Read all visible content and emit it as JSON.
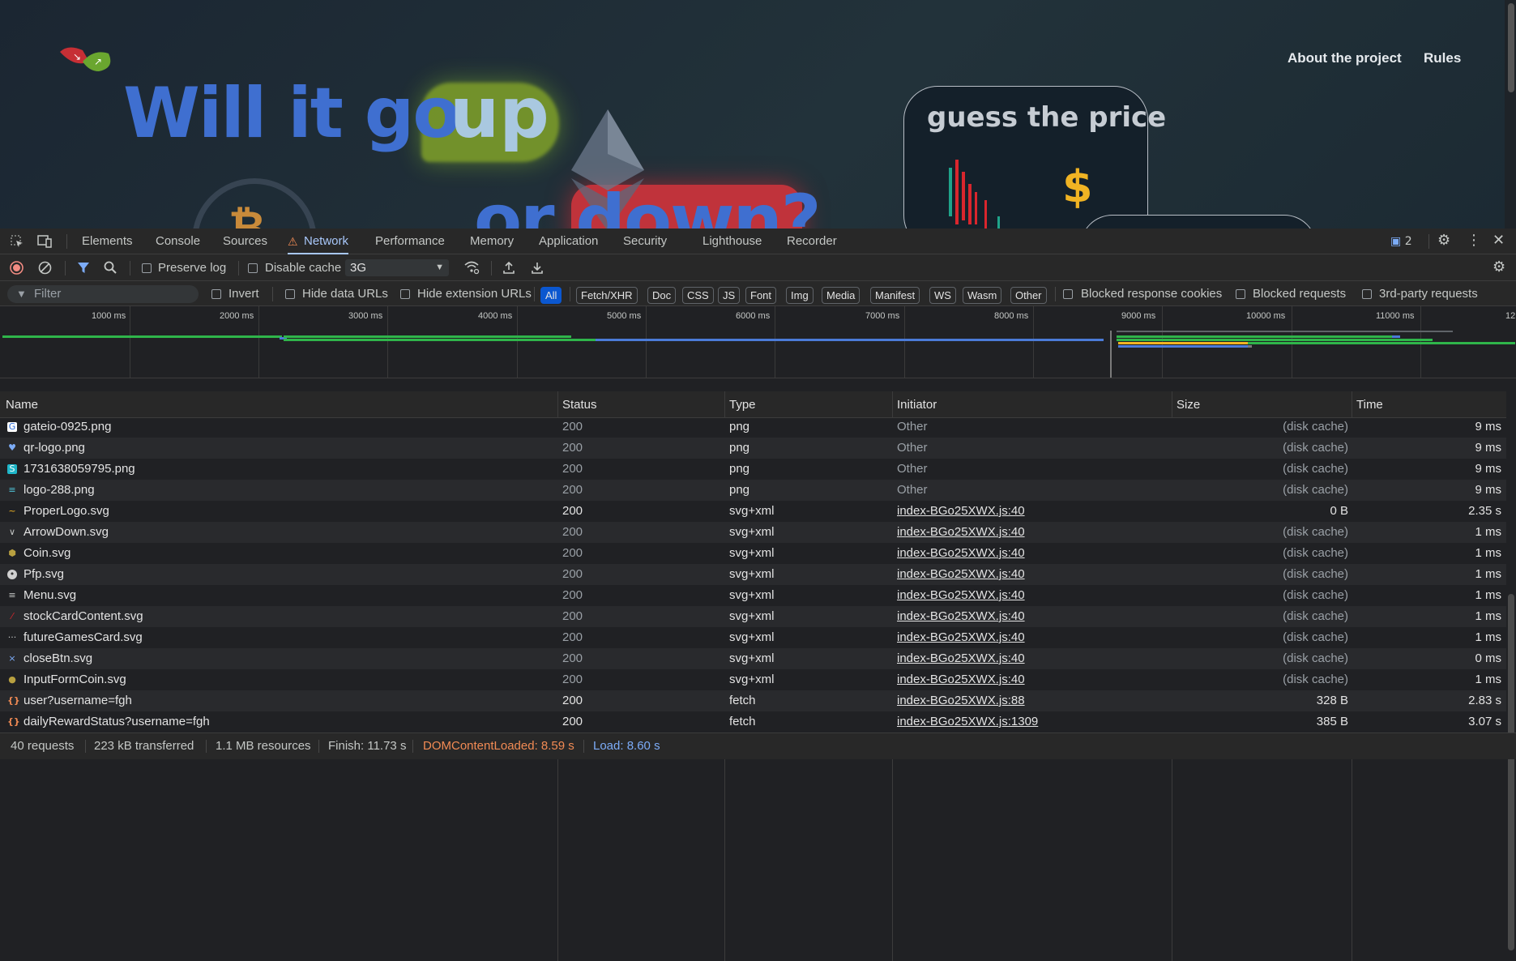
{
  "webpage": {
    "nav": {
      "about": "About the project",
      "rules": "Rules"
    },
    "hero": {
      "line1": "Will it go ",
      "up_word": "up",
      "line2": "or down?"
    },
    "price_card": {
      "title": "guess the price",
      "symbol": "$"
    },
    "btc_symbol": "₿",
    "colors": {
      "blue": "#3f6fd0",
      "up_green": "#7a9a2a",
      "down_red": "#c0333b",
      "gold": "#f0b323"
    }
  },
  "devtools": {
    "tabs": [
      {
        "label": "Elements"
      },
      {
        "label": "Console"
      },
      {
        "label": "Sources"
      },
      {
        "label": "Network",
        "active": true,
        "warning": true
      },
      {
        "label": "Performance"
      },
      {
        "label": "Memory"
      },
      {
        "label": "Application"
      },
      {
        "label": "Security"
      },
      {
        "label": "Lighthouse"
      },
      {
        "label": "Recorder"
      }
    ],
    "issues_count": "2",
    "toolbar": {
      "preserve_log": "Preserve log",
      "disable_cache": "Disable cache",
      "throttling": "3G"
    },
    "filterbar": {
      "filter_placeholder": "Filter",
      "invert": "Invert",
      "hide_data_urls": "Hide data URLs",
      "hide_extension_urls": "Hide extension URLs",
      "chips": [
        "All",
        "Fetch/XHR",
        "Doc",
        "CSS",
        "JS",
        "Font",
        "Img",
        "Media",
        "Manifest",
        "WS",
        "Wasm",
        "Other"
      ],
      "blocked_response_cookies": "Blocked response cookies",
      "blocked_requests": "Blocked requests",
      "third_party": "3rd-party requests"
    },
    "overview_ticks": [
      "1000 ms",
      "2000 ms",
      "3000 ms",
      "4000 ms",
      "5000 ms",
      "6000 ms",
      "7000 ms",
      "8000 ms",
      "9000 ms",
      "10000 ms",
      "11000 ms",
      "12"
    ],
    "columns": {
      "name": "Name",
      "status": "Status",
      "type": "Type",
      "initiator": "Initiator",
      "size": "Size",
      "time": "Time"
    },
    "rows": [
      {
        "name": "gateio-0925.png",
        "status": "200",
        "type": "png",
        "initiator": "Other",
        "size": "(disk cache)",
        "time": "9 ms",
        "icon": "gateio-icon"
      },
      {
        "name": "qr-logo.png",
        "status": "200",
        "type": "png",
        "initiator": "Other",
        "size": "(disk cache)",
        "time": "9 ms",
        "icon": "qr-icon"
      },
      {
        "name": "1731638059795.png",
        "status": "200",
        "type": "png",
        "initiator": "Other",
        "size": "(disk cache)",
        "time": "9 ms",
        "icon": "image-icon"
      },
      {
        "name": "logo-288.png",
        "status": "200",
        "type": "png",
        "initiator": "Other",
        "size": "(disk cache)",
        "time": "9 ms",
        "icon": "logo-icon"
      },
      {
        "name": "ProperLogo.svg",
        "status": "200",
        "type": "svg+xml",
        "initiator": "index-BGo25XWX.js:40",
        "size": "0 B",
        "time": "2.35 s",
        "icon": "proper-logo-icon"
      },
      {
        "name": "ArrowDown.svg",
        "status": "200",
        "type": "svg+xml",
        "initiator": "index-BGo25XWX.js:40",
        "size": "(disk cache)",
        "time": "1 ms",
        "icon": "arrow-down-icon"
      },
      {
        "name": "Coin.svg",
        "status": "200",
        "type": "svg+xml",
        "initiator": "index-BGo25XWX.js:40",
        "size": "(disk cache)",
        "time": "1 ms",
        "icon": "coin-icon"
      },
      {
        "name": "Pfp.svg",
        "status": "200",
        "type": "svg+xml",
        "initiator": "index-BGo25XWX.js:40",
        "size": "(disk cache)",
        "time": "1 ms",
        "icon": "profile-icon"
      },
      {
        "name": "Menu.svg",
        "status": "200",
        "type": "svg+xml",
        "initiator": "index-BGo25XWX.js:40",
        "size": "(disk cache)",
        "time": "1 ms",
        "icon": "menu-icon"
      },
      {
        "name": "stockCardContent.svg",
        "status": "200",
        "type": "svg+xml",
        "initiator": "index-BGo25XWX.js:40",
        "size": "(disk cache)",
        "time": "1 ms",
        "icon": "chart-icon"
      },
      {
        "name": "futureGamesCard.svg",
        "status": "200",
        "type": "svg+xml",
        "initiator": "index-BGo25XWX.js:40",
        "size": "(disk cache)",
        "time": "1 ms",
        "icon": "dots-icon"
      },
      {
        "name": "closeBtn.svg",
        "status": "200",
        "type": "svg+xml",
        "initiator": "index-BGo25XWX.js:40",
        "size": "(disk cache)",
        "time": "0 ms",
        "icon": "close-icon"
      },
      {
        "name": "InputFormCoin.svg",
        "status": "200",
        "type": "svg+xml",
        "initiator": "index-BGo25XWX.js:40",
        "size": "(disk cache)",
        "time": "1 ms",
        "icon": "coin-icon"
      },
      {
        "name": "user?username=fgh",
        "status": "200",
        "type": "fetch",
        "initiator": "index-BGo25XWX.js:88",
        "size": "328 B",
        "time": "2.83 s",
        "icon": "fetch-icon"
      },
      {
        "name": "dailyRewardStatus?username=fgh",
        "status": "200",
        "type": "fetch",
        "initiator": "index-BGo25XWX.js:1309",
        "size": "385 B",
        "time": "3.07 s",
        "icon": "fetch-icon"
      }
    ],
    "status_bar": {
      "requests": "40 requests",
      "transferred": "223 kB transferred",
      "resources": "1.1 MB resources",
      "finish": "Finish: 11.73 s",
      "dom_content_loaded": "DOMContentLoaded: 8.59 s",
      "load": "Load: 8.60 s"
    },
    "colors": {
      "accent": "#a8c7fa",
      "dcl": "#f28b54",
      "load": "#7cacf8"
    }
  }
}
